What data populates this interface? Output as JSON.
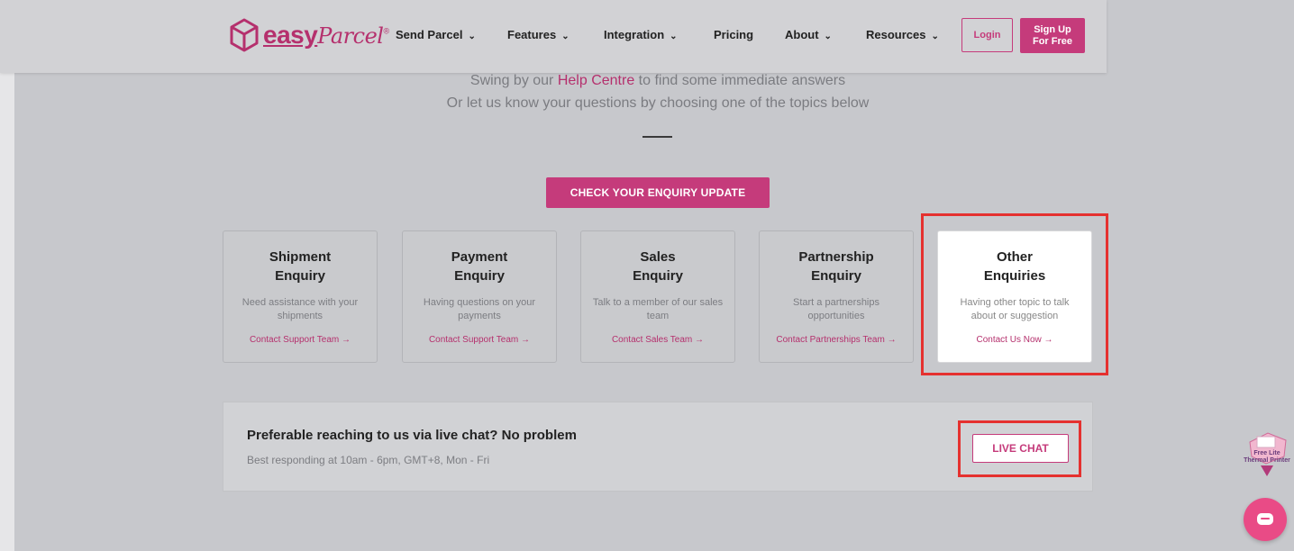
{
  "header": {
    "logo": {
      "word": "easy",
      "script": "Parcel",
      "mark": "®"
    },
    "nav": [
      {
        "label": "Send Parcel",
        "dropdown": true
      },
      {
        "label": "Features",
        "dropdown": true
      },
      {
        "label": "Integration",
        "dropdown": true
      },
      {
        "label": "Pricing",
        "dropdown": false
      },
      {
        "label": "About",
        "dropdown": true
      },
      {
        "label": "Resources",
        "dropdown": true
      }
    ],
    "login_label": "Login",
    "signup_line1": "Sign Up",
    "signup_line2": "For Free"
  },
  "intro": {
    "line1_before": "Swing by our",
    "line1_link": "Help Centre",
    "line1_after": "to find some immediate answers",
    "line2": "Or let us know your questions by choosing one of the topics below"
  },
  "check_button": "CHECK YOUR ENQUIRY UPDATE",
  "cards": [
    {
      "title1": "Shipment",
      "title2": "Enquiry",
      "desc": "Need assistance with your shipments",
      "link": "Contact Support Team →"
    },
    {
      "title1": "Payment",
      "title2": "Enquiry",
      "desc": "Having questions on your payments",
      "link": "Contact Support Team →"
    },
    {
      "title1": "Sales",
      "title2": "Enquiry",
      "desc": "Talk to a member of our sales team",
      "link": "Contact Sales Team →"
    },
    {
      "title1": "Partnership",
      "title2": "Enquiry",
      "desc": "Start a partnerships opportunities",
      "link": "Contact Partnerships Team →"
    },
    {
      "title1": "Other",
      "title2": "Enquiries",
      "desc": "Having other topic to talk about or suggestion",
      "link": "Contact Us Now →"
    }
  ],
  "live_chat": {
    "title": "Preferable reaching to us via live chat? No problem",
    "subtitle": "Best responding at 10am - 6pm, GMT+8, Mon - Fri",
    "button": "LIVE CHAT"
  },
  "promo": {
    "line1": "Free Lite",
    "line2": "Thermal Printer"
  },
  "colors": {
    "brand": "#c53b7b",
    "highlight": "#e5312f",
    "chat_bubble": "#e94b86"
  }
}
